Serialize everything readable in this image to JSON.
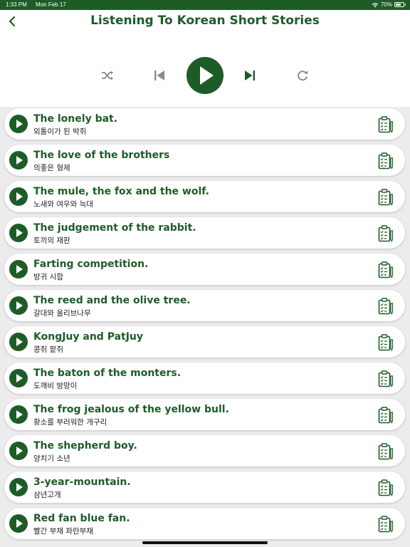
{
  "status": {
    "time": "1:33 PM",
    "date": "Mon Feb 17",
    "battery": "70%",
    "battery_level": 0.7
  },
  "header": {
    "title": "Listening To Korean Short Stories"
  },
  "colors": {
    "primary": "#1e5c27",
    "control_gray": "#8a8a8a"
  },
  "controls": {
    "shuffle_icon": "shuffle-icon",
    "prev_icon": "skip-previous-icon",
    "play_icon": "play-icon",
    "next_icon": "skip-next-icon",
    "repeat_icon": "repeat-icon"
  },
  "stories": [
    {
      "en": "The lonely bat.",
      "ko": "외톨이가 된 박쥐"
    },
    {
      "en": "The love of the brothers",
      "ko": "의좋은 형제"
    },
    {
      "en": "The mule, the fox and the wolf.",
      "ko": "노새와 여우와 늑대"
    },
    {
      "en": "The judgement of the rabbit.",
      "ko": "토끼의 재판"
    },
    {
      "en": "Farting competition.",
      "ko": "방귀 시합"
    },
    {
      "en": "The reed and the olive tree.",
      "ko": "갈대와 올리브나무"
    },
    {
      "en": "KongJuy and PatJuy",
      "ko": "콩쥐 팥쥐"
    },
    {
      "en": "The baton of the monters.",
      "ko": "도깨비 방망이"
    },
    {
      "en": "The frog jealous of the yellow bull.",
      "ko": "황소를 부러워한 개구리"
    },
    {
      "en": "The shepherd boy.",
      "ko": "양치기 소년"
    },
    {
      "en": "3-year-mountain.",
      "ko": "삼년고개"
    },
    {
      "en": "Red fan blue fan.",
      "ko": "빨간 부채 파란부채"
    }
  ]
}
